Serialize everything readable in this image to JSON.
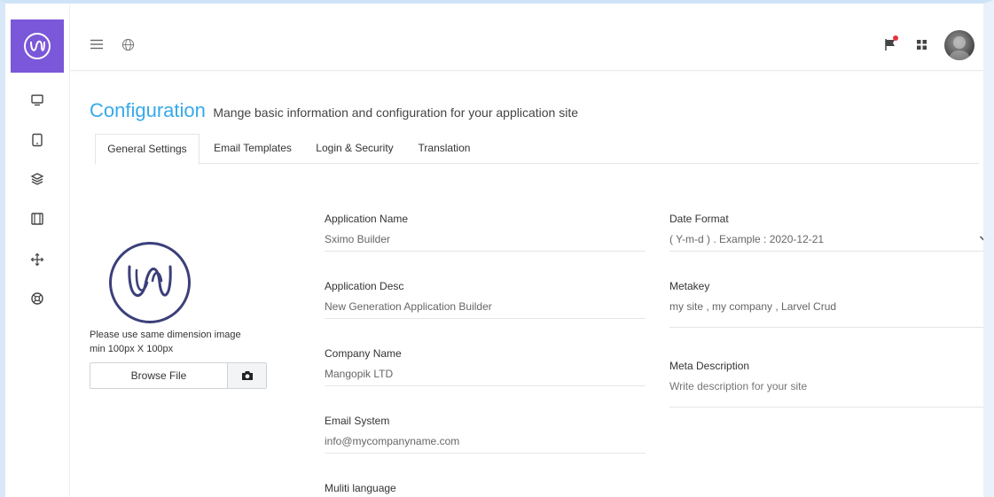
{
  "topbar": {
    "menu_icon": "hamburger-icon",
    "globe_icon": "globe-icon",
    "flag_icon": "flag-icon",
    "apps_icon": "grid-icon"
  },
  "sidebar": {
    "items": [
      {
        "icon": "monitor-icon"
      },
      {
        "icon": "tablet-icon"
      },
      {
        "icon": "layers-icon"
      },
      {
        "icon": "film-icon"
      },
      {
        "icon": "move-icon"
      },
      {
        "icon": "lifebuoy-icon"
      }
    ]
  },
  "page": {
    "title": "Configuration",
    "subtitle": "Mange basic information and configuration for your application site"
  },
  "tabs": [
    {
      "label": "General Settings",
      "active": true
    },
    {
      "label": "Email Templates",
      "active": false
    },
    {
      "label": "Login & Security",
      "active": false
    },
    {
      "label": "Translation",
      "active": false
    }
  ],
  "logo": {
    "hint_line1": "Please use same dimension image",
    "hint_line2": "min 100px X 100px",
    "browse_label": "Browse File"
  },
  "form": {
    "app_name": {
      "label": "Application Name",
      "value": "Sximo  Builder"
    },
    "app_desc": {
      "label": "Application Desc",
      "value": "New Generation Application Builder"
    },
    "company": {
      "label": "Company Name",
      "value": "Mangopik LTD"
    },
    "email": {
      "label": "Email System",
      "value": "info@mycompanyname.com"
    },
    "multi_lang": {
      "label": "Muliti language"
    },
    "date_format": {
      "label": "Date Format",
      "value": "( Y-m-d ) . Example : 2020-12-21"
    },
    "metakey": {
      "label": "Metakey",
      "value": "my site , my company  , Larvel Crud"
    },
    "meta_desc": {
      "label": "Meta Description",
      "placeholder": "Write description for your site"
    }
  },
  "colors": {
    "brand": "#7b57d9",
    "title": "#37a9e9",
    "notification": "#e5343d"
  }
}
